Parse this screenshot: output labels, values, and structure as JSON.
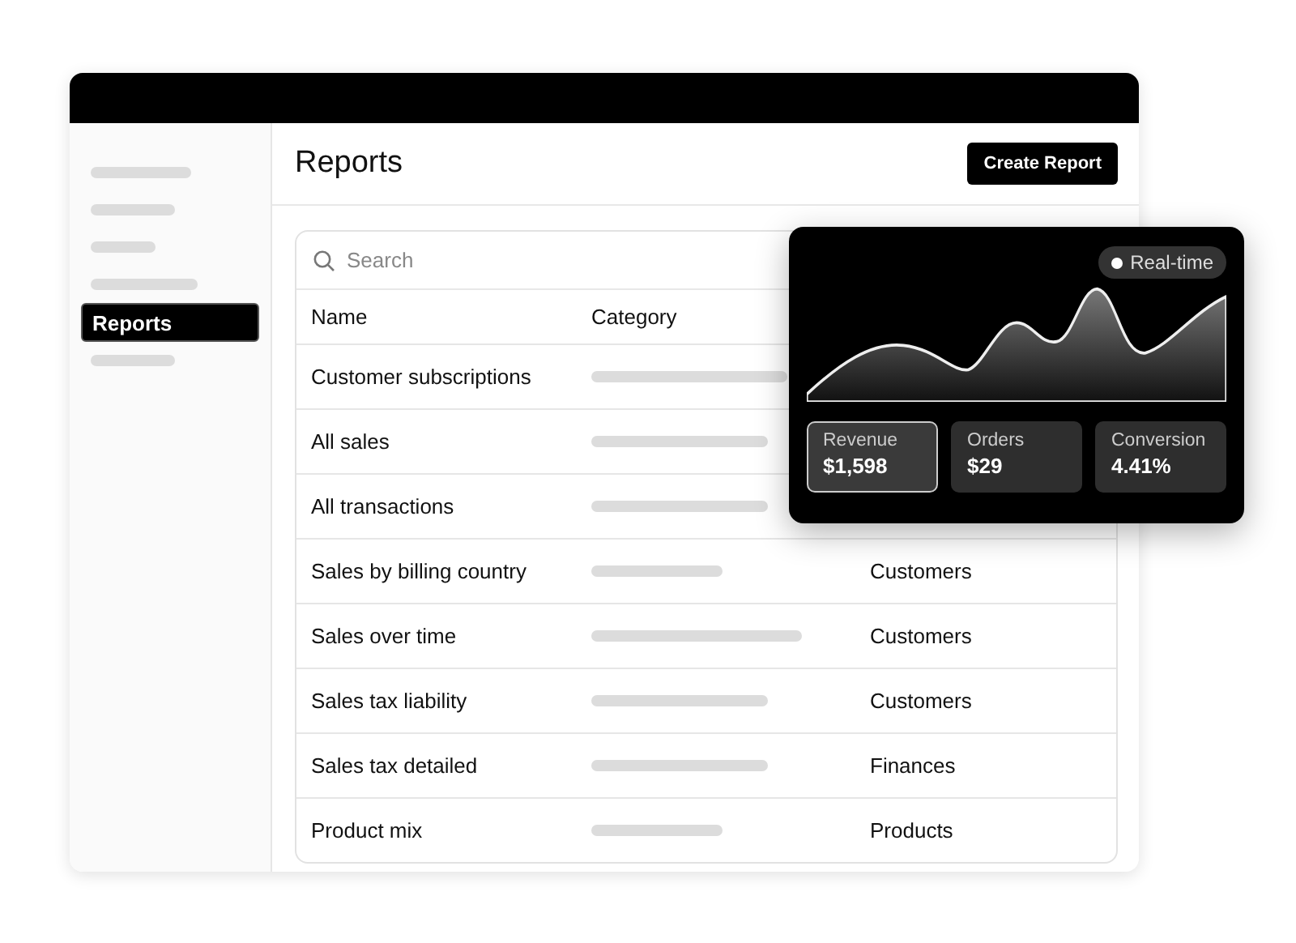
{
  "sidebar": {
    "items": [
      {
        "kind": "placeholder"
      },
      {
        "kind": "placeholder"
      },
      {
        "kind": "placeholder"
      },
      {
        "kind": "placeholder"
      },
      {
        "kind": "link",
        "label": "Reports",
        "selected": true
      },
      {
        "kind": "placeholder"
      }
    ]
  },
  "header": {
    "title": "Reports",
    "button": "Create Report"
  },
  "table": {
    "search": {
      "placeholder": "Search"
    },
    "columns": [
      "Name",
      "Category"
    ],
    "rows": [
      {
        "name": "Customer subscriptions"
      },
      {
        "name": "All sales"
      },
      {
        "name": "All transactions"
      },
      {
        "name": "Sales by billing country",
        "column_3": "Customers"
      },
      {
        "name": "Sales over time",
        "column_3": "Customers"
      },
      {
        "name": "Sales tax liability",
        "column_3": "Customers"
      },
      {
        "name": "Sales tax detailed",
        "column_3": "Finances"
      },
      {
        "name": "Product mix",
        "column_3": "Products"
      }
    ]
  },
  "overlay": {
    "badge": "Real-time",
    "stats": [
      {
        "label": "Revenue",
        "value": "$1,598",
        "selected": true
      },
      {
        "label": "Orders",
        "value": "$29",
        "selected": false
      },
      {
        "label": "Conversion",
        "value": "4.41%",
        "selected": false
      }
    ]
  }
}
